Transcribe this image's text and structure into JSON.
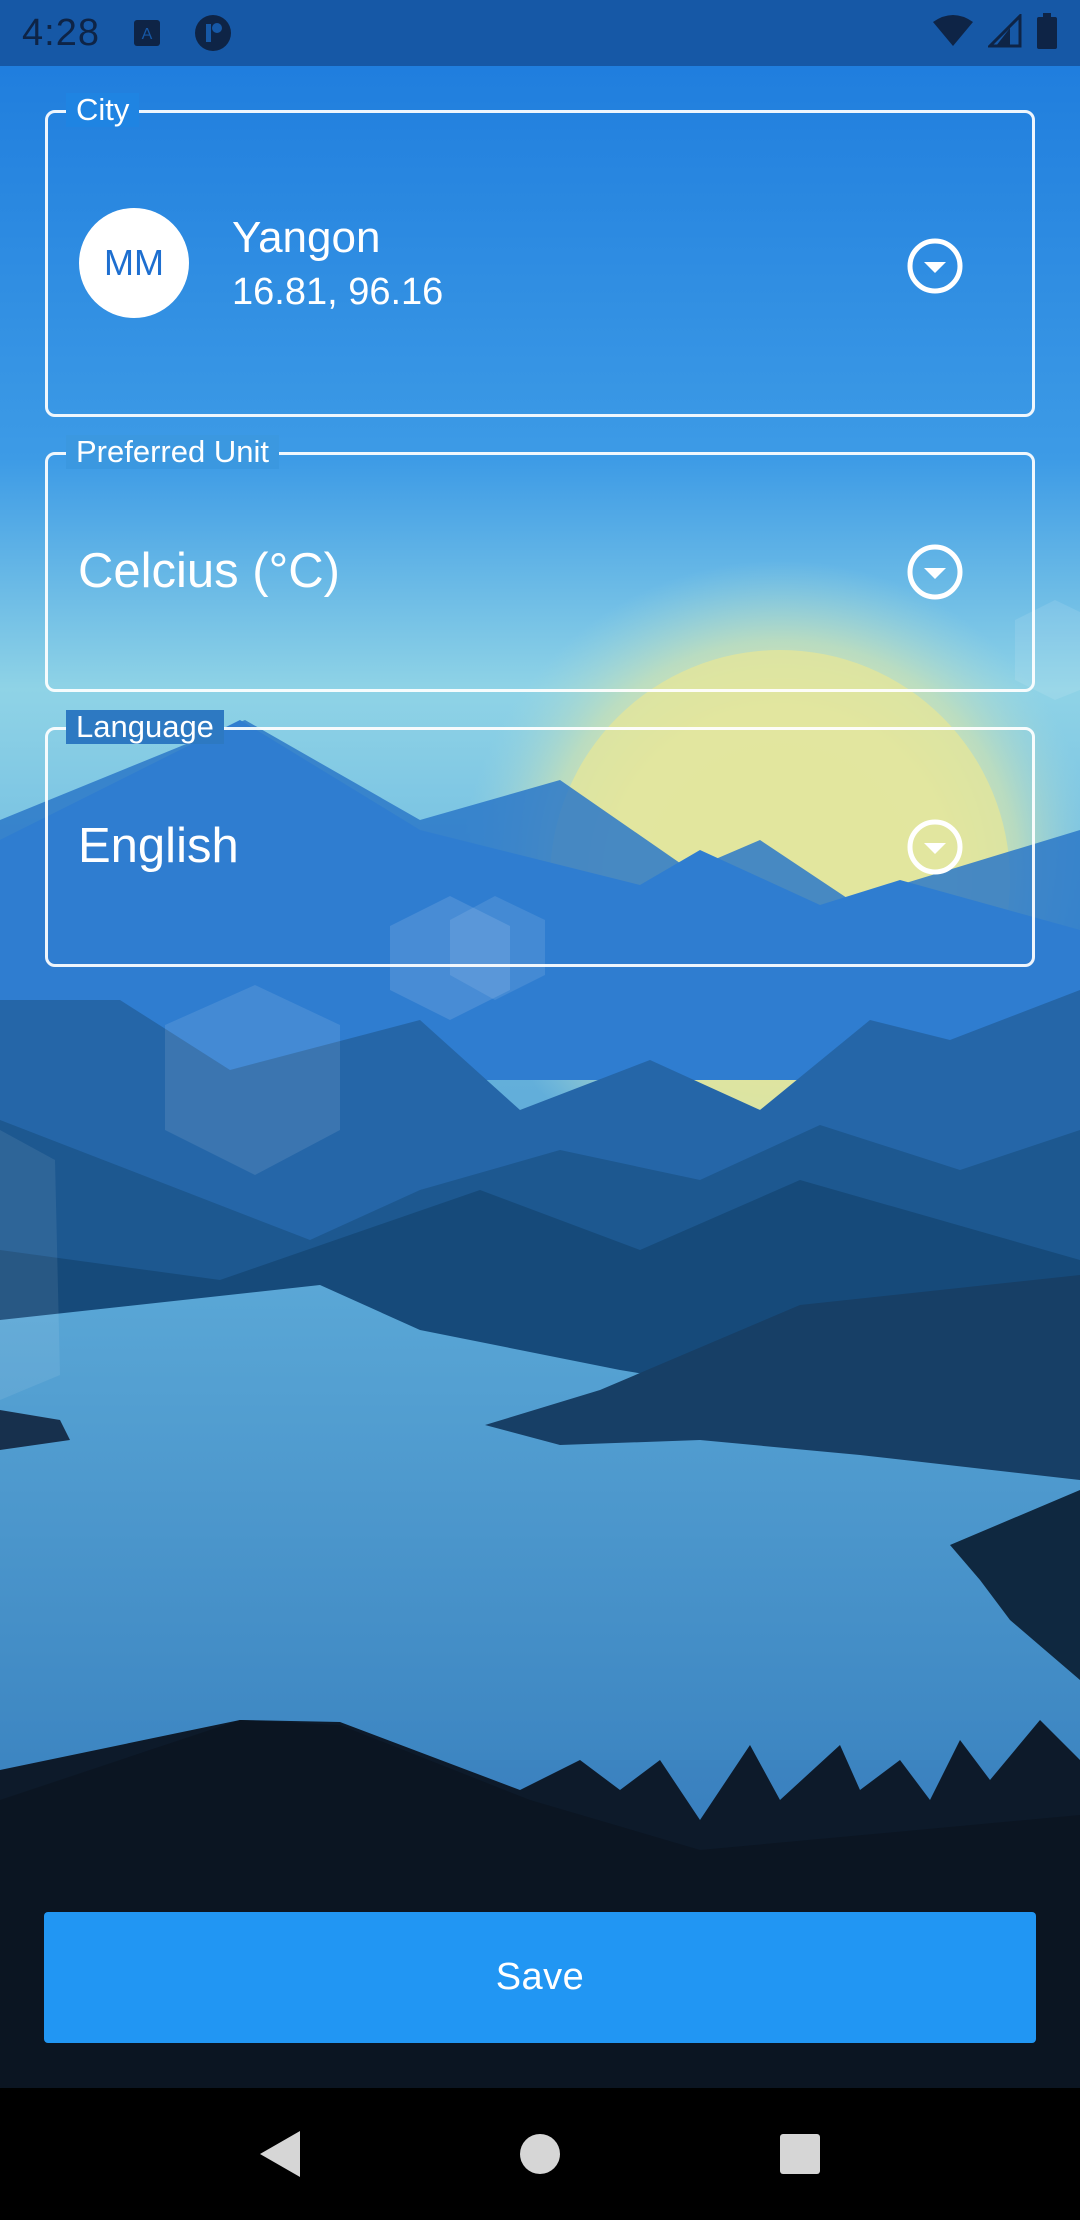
{
  "status_bar": {
    "time": "4:28",
    "icons": [
      "keyboard-a-icon",
      "app-notification-icon",
      "wifi-icon",
      "signal-icon",
      "battery-icon"
    ]
  },
  "city_field": {
    "label": "City",
    "avatar_initials": "MM",
    "city_name": "Yangon",
    "coordinates": "16.81, 96.16",
    "icon": "dropdown-circle-icon"
  },
  "unit_field": {
    "label": "Preferred Unit",
    "value": "Celcius (°C)",
    "icon": "dropdown-circle-icon"
  },
  "language_field": {
    "label": "Language",
    "value": "English",
    "icon": "dropdown-circle-icon"
  },
  "save_button": {
    "label": "Save"
  },
  "nav_bar": {
    "icons": [
      "back-icon",
      "home-icon",
      "recents-icon"
    ]
  },
  "colors": {
    "accent": "#2196f3",
    "status_bar": "#1658a6",
    "sky_top": "#1b7fe3",
    "sun": "#e3e9a0",
    "dark_ground": "#0c1724"
  }
}
